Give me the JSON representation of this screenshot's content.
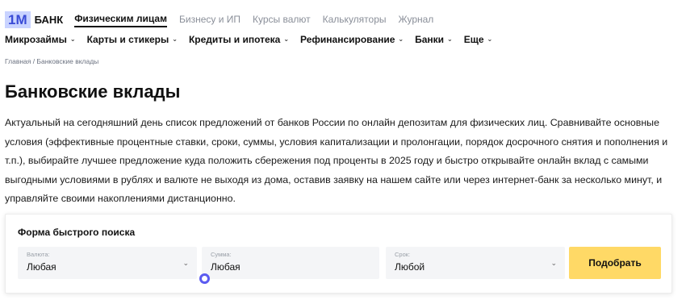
{
  "logo": {
    "mark": "1M",
    "text": "БАНК"
  },
  "segments": [
    {
      "label": "Физическим лицам",
      "active": true
    },
    {
      "label": "Бизнесу и ИП",
      "active": false
    },
    {
      "label": "Курсы валют",
      "active": false
    },
    {
      "label": "Калькуляторы",
      "active": false
    },
    {
      "label": "Журнал",
      "active": false
    }
  ],
  "mainnav": [
    {
      "label": "Микрозаймы"
    },
    {
      "label": "Карты и стикеры"
    },
    {
      "label": "Кредиты и ипотека"
    },
    {
      "label": "Рефинансирование"
    },
    {
      "label": "Банки"
    },
    {
      "label": "Еще"
    }
  ],
  "breadcrumb": "Главная / Банковские вклады",
  "page_title": "Банковские вклады",
  "intro": "Актуальный на сегодняшний день список предложений от банков России по онлайн депозитам для физических лиц. Сравнивайте основные условия (эффективные процентные ставки, сроки, суммы, условия капитализации и пролонгации, порядок досрочного снятия и пополнения и т.п.), выбирайте лучшее предложение куда положить сбережения под проценты в 2025 году и быстро открывайте онлайн вклад с самыми выгодными условиями в рублях и валюте не выходя из дома, оставив заявку на нашем сайте или через интернет-банк за несколько минут, и управляйте своими накоплениями дистанционно.",
  "search": {
    "title": "Форма быстрого поиска",
    "currency": {
      "label": "Валюта:",
      "value": "Любая"
    },
    "amount": {
      "label": "Сумма:",
      "value": "Любая"
    },
    "term": {
      "label": "Срок:",
      "value": "Любой"
    },
    "submit": "Подобрать"
  },
  "colors": {
    "accent": "#ffd966",
    "logo_bg": "#c9d3ff",
    "logo_fg": "#3a4bd6",
    "cursor": "#5b5bf0"
  }
}
